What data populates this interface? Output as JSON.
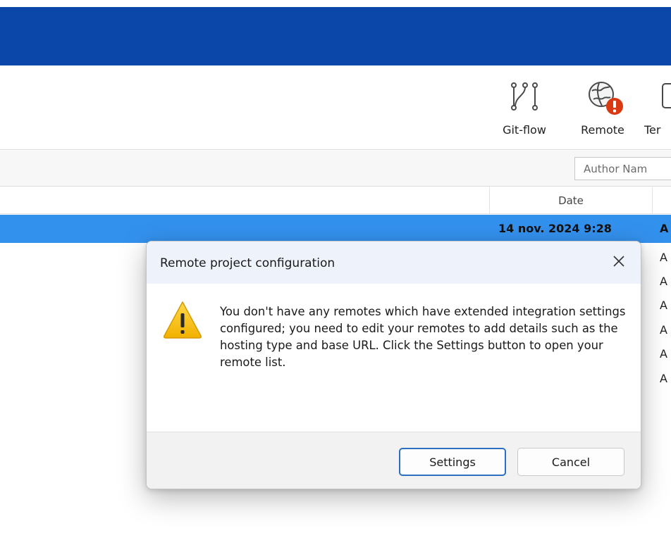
{
  "toolbar": {
    "gitflow_label": "Git-flow",
    "remote_label": "Remote",
    "terminal_label": "Ter"
  },
  "filter": {
    "author_placeholder": "Author Nam"
  },
  "commit_list": {
    "columns": {
      "date": "Date"
    },
    "selected_row": {
      "date": "14 nov. 2024 9:28",
      "author_initial": "A"
    },
    "other_rows_author_initials": [
      "A",
      "A",
      "A",
      "A",
      "A",
      "A"
    ]
  },
  "dialog": {
    "title": "Remote project configuration",
    "message": "You don't have any remotes which have extended integration settings configured; you need to edit your remotes to add details such as the hosting type and base URL. Click the Settings button to open your remote list.",
    "buttons": {
      "settings": "Settings",
      "cancel": "Cancel"
    }
  },
  "icons": {
    "gitflow": "git-flow-icon",
    "remote": "globe-icon",
    "remote_badge": "error-badge-icon",
    "terminal": "terminal-icon",
    "warning": "warning-icon",
    "close": "close-icon"
  },
  "colors": {
    "title_bar": "#0a47a9",
    "selection": "#3391ee",
    "error_badge": "#d93a12",
    "warning": "#f7c326",
    "default_button_border": "#2b6fc3"
  }
}
